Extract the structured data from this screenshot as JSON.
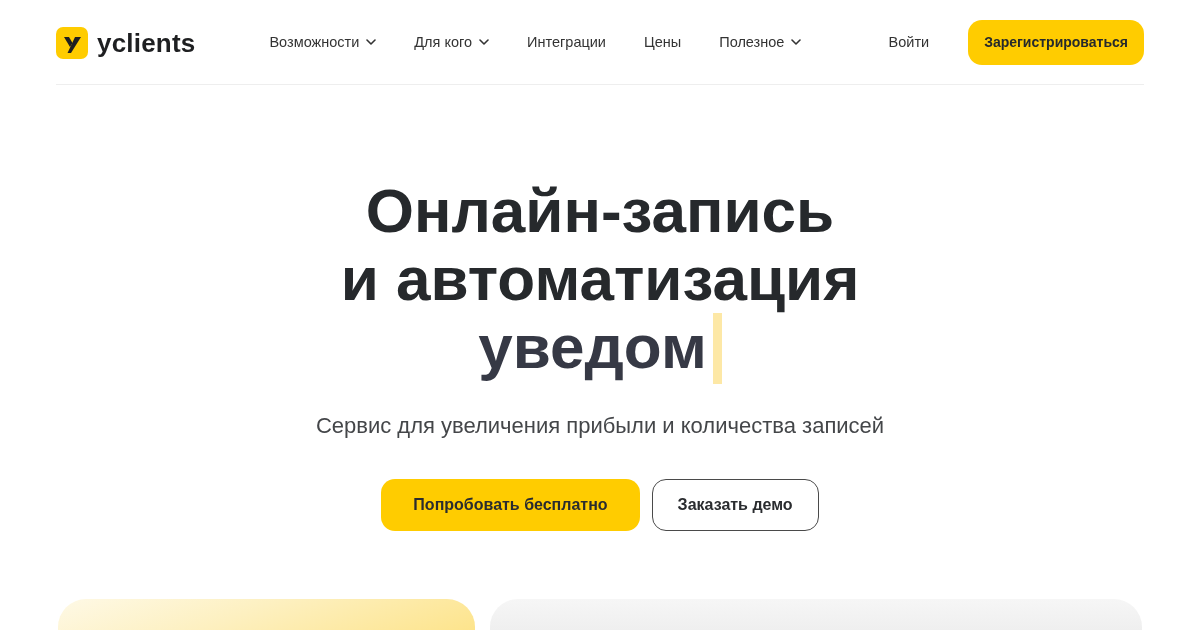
{
  "header": {
    "logo": {
      "text": "yclients"
    },
    "nav": [
      {
        "label": "Возможности",
        "has_menu": true
      },
      {
        "label": "Для кого",
        "has_menu": true
      },
      {
        "label": "Интеграции",
        "has_menu": false
      },
      {
        "label": "Цены",
        "has_menu": false
      },
      {
        "label": "Полезное",
        "has_menu": true
      }
    ],
    "login_link": "Войти",
    "register_button": "Зарегистрироваться"
  },
  "hero": {
    "title_lines": [
      "Онлайн-запись",
      "и автоматизация"
    ],
    "typed_text": "уведом",
    "subtitle": "Сервис для увеличения прибыли и количества записей",
    "buttons": [
      {
        "label": "Попробовать бесплатно",
        "kind": "primary"
      },
      {
        "label": "Заказать демо",
        "kind": "outline"
      }
    ]
  }
}
